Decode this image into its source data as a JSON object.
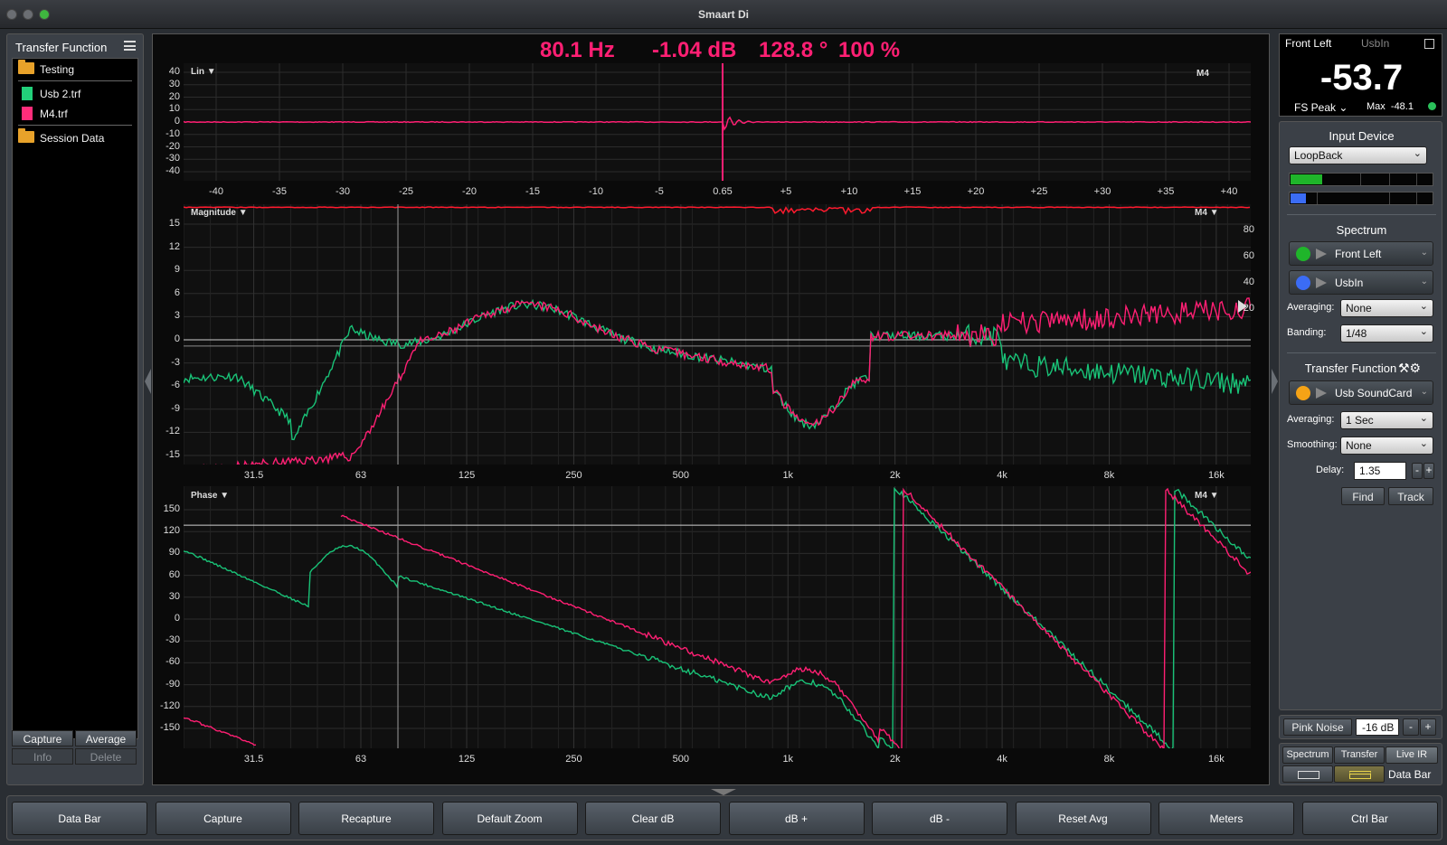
{
  "window": {
    "title": "Smaart Di"
  },
  "left_panel": {
    "title": "Transfer Function",
    "tree": [
      {
        "label": "Testing",
        "type": "folder"
      },
      {
        "label": "Usb 2.trf",
        "type": "file-green"
      },
      {
        "label": "M4.trf",
        "type": "file-pink"
      },
      {
        "label": "Session Data",
        "type": "folder"
      }
    ],
    "buttons": {
      "capture": "Capture",
      "average": "Average",
      "info": "Info",
      "delete": "Delete"
    }
  },
  "readout": {
    "freq": "80.1 Hz",
    "db": "-1.04 dB",
    "phase": "128.8 °",
    "coherence": "100 %"
  },
  "plots": {
    "ir": {
      "label": "Lin ▼",
      "tag": "M4",
      "y_ticks": [
        "40",
        "30",
        "20",
        "10",
        "0",
        "-10",
        "-20",
        "-30",
        "-40"
      ],
      "x_ticks": [
        "-40",
        "-35",
        "-30",
        "-25",
        "-20",
        "-15",
        "-10",
        "-5",
        "0.65",
        "+5",
        "+10",
        "+15",
        "+20",
        "+25",
        "+30",
        "+35",
        "+40"
      ]
    },
    "magnitude": {
      "label": "Magnitude ▼",
      "tag": "M4 ▼",
      "y_ticks": [
        "15",
        "12",
        "9",
        "6",
        "3",
        "0",
        "-3",
        "-6",
        "-9",
        "-12",
        "-15"
      ],
      "y_right_ticks": [
        "80",
        "60",
        "40",
        "20"
      ],
      "x_ticks": [
        "31.5",
        "63",
        "125",
        "250",
        "500",
        "1k",
        "2k",
        "4k",
        "8k",
        "16k"
      ]
    },
    "phase": {
      "label": "Phase ▼",
      "tag": "M4 ▼",
      "y_ticks": [
        "150",
        "120",
        "90",
        "60",
        "30",
        "0",
        "-30",
        "-60",
        "-90",
        "-120",
        "-150"
      ],
      "x_ticks": [
        "31.5",
        "63",
        "125",
        "250",
        "500",
        "1k",
        "2k",
        "4k",
        "8k",
        "16k"
      ]
    },
    "colors": {
      "measure": "#ff1f73",
      "reference": "#19c277",
      "coherence": "#ff1a2e",
      "cursor": "#9a9a9a"
    }
  },
  "meter": {
    "channel": "Front Left",
    "alt_channel": "UsbIn",
    "value": "-53.7",
    "mode": "FS Peak",
    "max_label": "Max",
    "max_value": "-48.1"
  },
  "right_panel": {
    "input_device": {
      "title": "Input Device",
      "value": "LoopBack",
      "level_green": 0.22,
      "level_blue": 0.11
    },
    "spectrum": {
      "title": "Spectrum",
      "channels": [
        {
          "label": "Front Left",
          "color": "#1fb52a"
        },
        {
          "label": "UsbIn",
          "color": "#3b6cf5"
        }
      ],
      "averaging_label": "Averaging:",
      "averaging": "None",
      "banding_label": "Banding:",
      "banding": "1/48"
    },
    "transfer": {
      "title": "Transfer Function",
      "channel": {
        "label": "Usb SoundCard",
        "color": "#f5a316"
      },
      "averaging_label": "Averaging:",
      "averaging": "1 Sec",
      "smoothing_label": "Smoothing:",
      "smoothing": "None",
      "delay_label": "Delay:",
      "delay": "1.35",
      "find": "Find",
      "track": "Track"
    },
    "pink_noise": {
      "label": "Pink Noise",
      "level": "-16 dB",
      "minus": "-",
      "plus": "+"
    },
    "views": {
      "spectrum": "Spectrum",
      "transfer": "Transfer",
      "live_ir": "Live IR",
      "data_bar": "Data Bar"
    }
  },
  "command_bar": [
    "Data Bar",
    "Capture",
    "Recapture",
    "Default Zoom",
    "Clear dB",
    "dB +",
    "dB -",
    "Reset Avg",
    "Meters",
    "Ctrl Bar"
  ]
}
